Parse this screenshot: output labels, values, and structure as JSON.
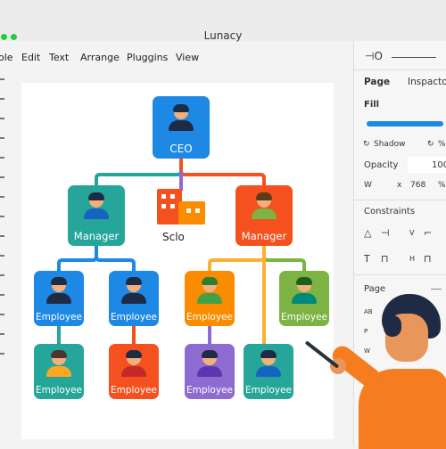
{
  "window": {
    "title": "Lunacy"
  },
  "menu": {
    "items": [
      "ole",
      "Edit",
      "Text",
      "Arrange",
      "Pluggins",
      "View"
    ]
  },
  "chart": {
    "ceo_label": "CEO",
    "middle_label": "Sclo",
    "manager_left": "Manager",
    "manager_right": "Manager",
    "employees_row1": [
      "Employee",
      "Employee",
      "Employee",
      "Employee"
    ],
    "employees_row2": [
      "Employee",
      "Employee",
      "Employee",
      "Employee"
    ]
  },
  "panel": {
    "toolbar_symbol": "⊣O",
    "tab_page": "Page",
    "tab_inspector": "Inspactor",
    "fill_label": "Fill",
    "shadow_label": "Shadow",
    "shadow_pct": "%",
    "opacity_label": "Opacity",
    "opacity_value": "100",
    "w_label": "W",
    "x_label": "x",
    "w_value": "768",
    "w_unit": "%",
    "constraints_label": "Constraints",
    "v_label": "V",
    "h_label": "H",
    "page_label": "Page",
    "ab_label": "AB",
    "p_label": "P",
    "w2_label": "W"
  },
  "colors": {
    "ceo": "#1e88e5",
    "manager_left": "#26a69a",
    "manager_right": "#f4511e",
    "row1": [
      "#1e88e5",
      "#1e88e5",
      "#fb8c00",
      "#7cb342"
    ],
    "row2": [
      "#26a69a",
      "#f4511e",
      "#8e6bd0",
      "#26a69a"
    ],
    "accent": "#1e88e5"
  }
}
